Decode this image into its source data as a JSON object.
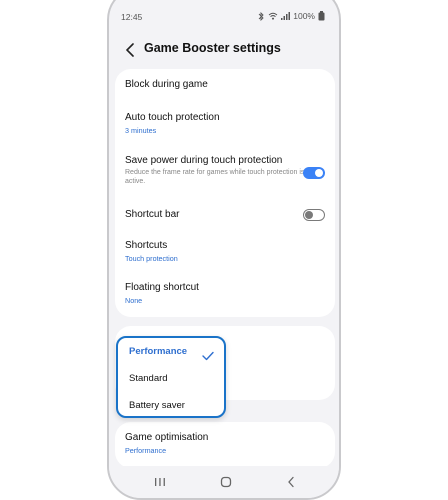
{
  "status": {
    "time": "12:45",
    "battery": "100%"
  },
  "header": {
    "title": "Game Booster settings"
  },
  "settings": {
    "block_during_game": {
      "title": "Block during game"
    },
    "auto_touch": {
      "title": "Auto touch protection",
      "value": "3 minutes"
    },
    "save_power": {
      "title": "Save power during touch protection",
      "desc": "Reduce the frame rate for games while touch protection is active.",
      "enabled": true
    },
    "shortcut_bar": {
      "title": "Shortcut bar",
      "enabled": false
    },
    "shortcuts": {
      "title": "Shortcuts",
      "value": "Touch protection"
    },
    "floating_shortcut": {
      "title": "Floating shortcut",
      "value": "None"
    },
    "game_optimisation": {
      "title": "Game optimisation",
      "value": "Performance"
    }
  },
  "dropdown": {
    "options": [
      "Performance",
      "Standard",
      "Battery saver"
    ],
    "selected": "Performance"
  },
  "colors": {
    "accent": "#3b82f6",
    "highlight_border": "#1a73c8",
    "subtext": "#2f6fcf"
  }
}
